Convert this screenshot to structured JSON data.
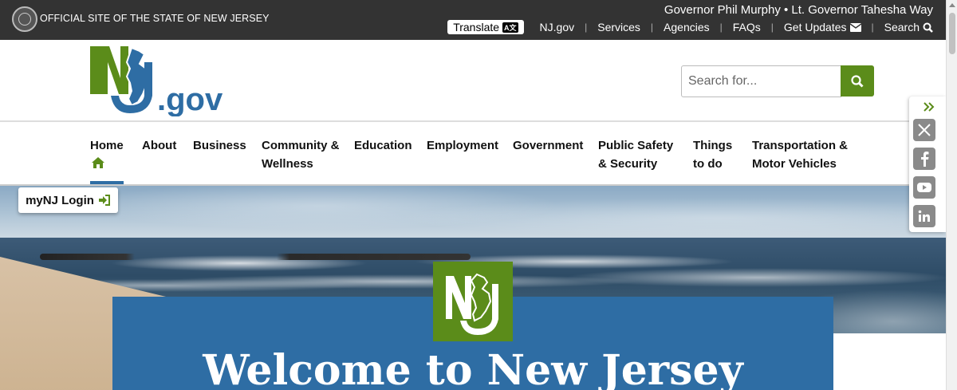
{
  "topbar": {
    "official_text": "OFFICIAL SITE OF THE STATE OF NEW JERSEY",
    "governor_text": "Governor Phil Murphy • Lt. Governor Tahesha Way",
    "translate_label": "Translate",
    "links": {
      "njgov": "NJ.gov",
      "services": "Services",
      "agencies": "Agencies",
      "faqs": "FAQs",
      "get_updates": "Get Updates",
      "search": "Search"
    }
  },
  "header": {
    "logo_text": "NJ.gov",
    "logo_suffix": ".gov",
    "search_placeholder": "Search for..."
  },
  "nav": {
    "home": "Home",
    "about": "About",
    "business": "Business",
    "community_line1": "Community &",
    "community_line2": "Wellness",
    "education": "Education",
    "employment": "Employment",
    "government": "Government",
    "safety_line1": "Public Safety",
    "safety_line2": "& Security",
    "things_line1": "Things",
    "things_line2": "to do",
    "transport_line1": "Transportation &",
    "transport_line2": "Motor Vehicles"
  },
  "hero": {
    "mynj_label": "myNJ Login",
    "welcome": "Welcome to New Jersey"
  },
  "social": [
    "x-icon",
    "facebook-icon",
    "youtube-icon",
    "linkedin-icon"
  ],
  "colors": {
    "topbar": "#333333",
    "green": "#5b8c1a",
    "blue": "#2e6da4"
  }
}
